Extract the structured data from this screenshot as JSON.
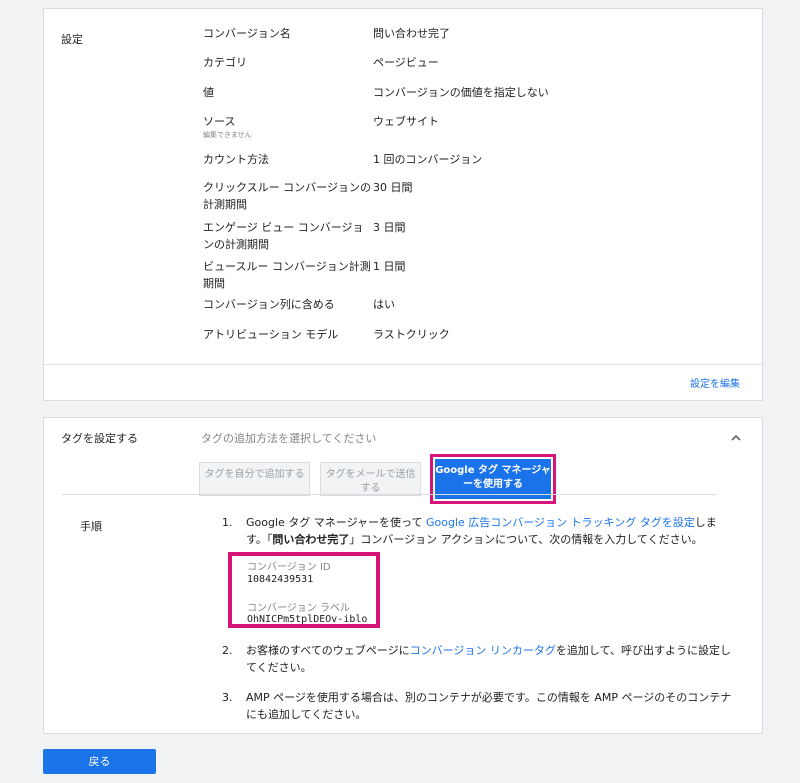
{
  "settings": {
    "section_label": "設定",
    "rows": [
      {
        "label": "コンバージョン名",
        "value": "問い合わせ完了"
      },
      {
        "label": "カテゴリ",
        "value": "ページビュー"
      },
      {
        "label": "値",
        "value": "コンバージョンの価値を指定しない"
      },
      {
        "label": "ソース",
        "sub": "編集できません",
        "value": "ウェブサイト"
      },
      {
        "label": "カウント方法",
        "value": "1 回のコンバージョン"
      },
      {
        "label": "クリックスルー コンバージョンの計測期間",
        "value": "30 日間"
      },
      {
        "label": "エンゲージ ビュー コンバージョンの計測期間",
        "value": "3 日間"
      },
      {
        "label": "ビュースルー コンバージョン計測期間",
        "value": "1 日間"
      },
      {
        "label": "コンバージョン列に含める",
        "value": "はい"
      },
      {
        "label": "アトリビューション モデル",
        "value": "ラストクリック"
      }
    ],
    "edit_link": "設定を編集"
  },
  "tag_setup": {
    "section_label": "タグを設定する",
    "placeholder": "タグの追加方法を選択してください",
    "options": [
      {
        "label": "タグを自分で追加する"
      },
      {
        "label": "タグをメールで送信する"
      },
      {
        "label": "Google タグ マネージャーを使用する"
      }
    ],
    "steps_label": "手順",
    "step1": {
      "num": "1.",
      "text_a": "Google タグ マネージャーを使って ",
      "link": "Google 広告コンバージョン トラッキング タグを設定",
      "text_b": "します。「",
      "bold": "問い合わせ完了",
      "text_c": "」コンバージョン アクションについて、次の情報を入力してください。"
    },
    "conversion_id_label": "コンバージョン ID",
    "conversion_id": "10842439531",
    "conversion_label_label": "コンバージョン ラベル",
    "conversion_label": "OhNICPm5tplDEOv-iblo",
    "step2": {
      "num": "2.",
      "text_a": "お客様のすべてのウェブページに",
      "link": "コンバージョン リンカータグ",
      "text_b": "を追加して、呼び出すように設定してください。"
    },
    "step3": {
      "num": "3.",
      "text": "AMP ページを使用する場合は、別のコンテナが必要です。この情報を AMP ページのそのコンテナにも追加してください。"
    }
  },
  "back_button": "戻る",
  "colors": {
    "accent": "#1a73e8",
    "highlight": "#d6147a",
    "background": "#f1f3f4"
  }
}
